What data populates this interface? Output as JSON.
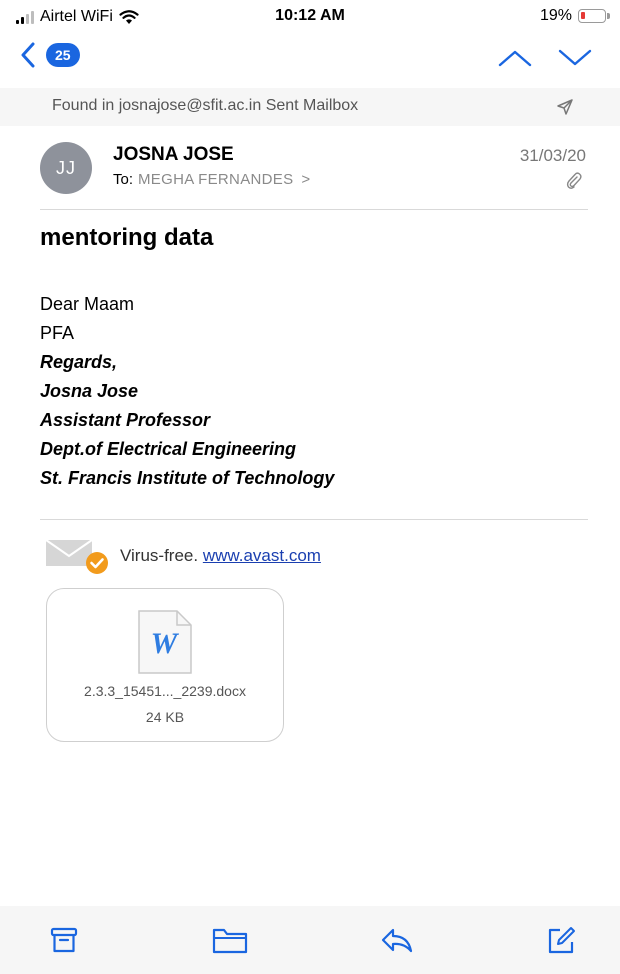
{
  "status_bar": {
    "carrier": "Airtel WiFi",
    "time": "10:12 AM",
    "battery_percent_text": "19%",
    "battery_level": 0.19,
    "battery_color": "#e53935"
  },
  "nav": {
    "back_icon": "chevron-left-icon",
    "unread_count": "25",
    "badge_color": "#1a66e0",
    "prev_icon": "chevron-up-icon",
    "next_icon": "chevron-down-icon"
  },
  "found_bar": {
    "text": "Found in josnajose@sfit.ac.in Sent Mailbox",
    "icon": "sent-arrow-icon"
  },
  "message": {
    "avatar_initials": "JJ",
    "sender": "JOSNA JOSE",
    "to_label": "To:",
    "recipient": "MEGHA FERNANDES",
    "recipient_chevron": ">",
    "date": "31/03/20",
    "subject": "mentoring data",
    "body_lines": [
      "Dear Maam",
      "PFA"
    ],
    "signature_lines": [
      "Regards,",
      "Josna Jose",
      "Assistant Professor",
      "Dept.of Electrical Engineering",
      "St. Francis Institute of Technology"
    ]
  },
  "avast": {
    "label": "Virus-free.",
    "link_text": "www.avast.com"
  },
  "attachment": {
    "icon_letter": "W",
    "file_name": "2.3.3_15451..._2239.docx",
    "file_size": "24 KB"
  },
  "toolbar": {
    "archive_icon": "archive-icon",
    "move_icon": "folder-icon",
    "reply_icon": "reply-icon",
    "compose_icon": "compose-icon",
    "accent_color": "#1a66e0"
  }
}
